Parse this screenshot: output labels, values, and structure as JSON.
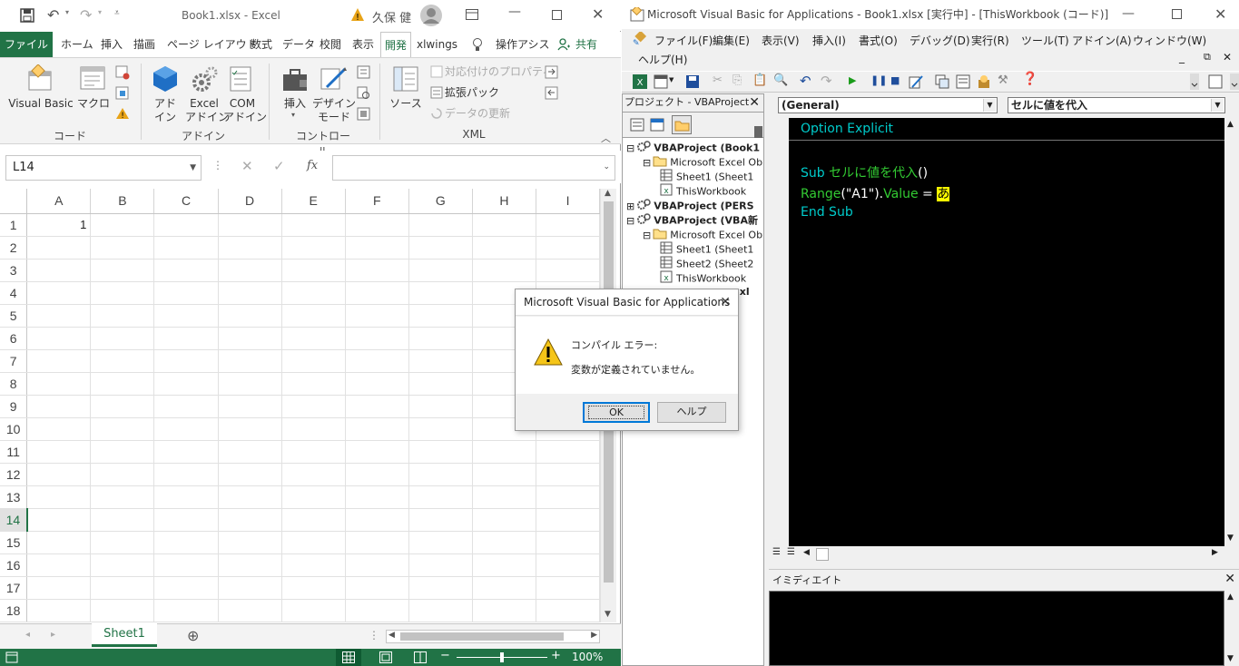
{
  "excel": {
    "title": "Book1.xlsx - Excel",
    "user": "久保 健",
    "tabs": [
      "ファイル",
      "ホーム",
      "挿入",
      "描画",
      "ページ レイアウト",
      "数式",
      "データ",
      "校閲",
      "表示",
      "開発",
      "xlwings"
    ],
    "tell_me": "操作アシス",
    "share": "共有",
    "ribbon": {
      "visual_basic": "Visual Basic",
      "macro": "マクロ",
      "addins": "アド\nイン",
      "excel_addins_1": "Excel",
      "excel_addins_2": "アドイン",
      "com_addins_1": "COM",
      "com_addins_2": "アドイン",
      "insert": "挿入",
      "design_mode_1": "デザイン",
      "design_mode_2": "モード",
      "source": "ソース",
      "map_props": "対応付けのプロパティ",
      "ext_pack": "拡張パック",
      "refresh_data": "データの更新",
      "group_code": "コード",
      "group_addins": "アドイン",
      "group_controls": "コントロール",
      "group_xml": "XML",
      "addin_a": "アド",
      "addin_b": "イン"
    },
    "name_box": "L14",
    "fx": "fx",
    "columns": [
      "A",
      "B",
      "C",
      "D",
      "E",
      "F",
      "G",
      "H",
      "I"
    ],
    "rows": [
      "1",
      "2",
      "3",
      "4",
      "5",
      "6",
      "7",
      "8",
      "9",
      "10",
      "11",
      "12",
      "13",
      "14",
      "15",
      "16",
      "17",
      "18"
    ],
    "cell_a1": "1",
    "sheet_tab": "Sheet1",
    "zoom": "100%"
  },
  "vbe": {
    "title": "Microsoft Visual Basic for Applications - Book1.xlsx [実行中] - [ThisWorkbook (コード)]",
    "menu": [
      "ファイル(F)",
      "編集(E)",
      "表示(V)",
      "挿入(I)",
      "書式(O)",
      "デバッグ(D)",
      "実行(R)",
      "ツール(T)",
      "アドイン(A)",
      "ウィンドウ(W)"
    ],
    "help_menu": "ヘルプ(H)",
    "project_title": "プロジェクト - VBAProject",
    "tree": [
      {
        "label": "VBAProject (Book1",
        "bold": true
      },
      {
        "label": "Microsoft Excel Ob",
        "bold": false
      },
      {
        "label": "Sheet1 (Sheet1",
        "bold": false
      },
      {
        "label": "ThisWorkbook",
        "bold": false
      },
      {
        "label": "VBAProject (PERS",
        "bold": true
      },
      {
        "label": "VBAProject (VBA新",
        "bold": true
      },
      {
        "label": "Microsoft Excel Ob",
        "bold": false
      },
      {
        "label": "Sheet1 (Sheet1",
        "bold": false
      },
      {
        "label": "Sheet2 (Sheet2",
        "bold": false
      },
      {
        "label": "ThisWorkbook",
        "bold": false
      },
      {
        "label": "s.xl",
        "bold": true
      }
    ],
    "combo_general": "(General)",
    "combo_proc": "セルに値を代入",
    "code": {
      "line1": "Option Explicit",
      "line2_kw": "Sub ",
      "line2_name": "セルに値を代入",
      "line2_paren": "()",
      "line3_range": "Range",
      "line3_args": "(\"A1\").",
      "line3_value": "Value",
      "line3_eq": " = ",
      "line3_hl": "あ",
      "line4": "End Sub"
    },
    "immediate_title": "イミディエイト"
  },
  "dialog": {
    "title": "Microsoft Visual Basic for Applications",
    "heading": "コンパイル エラー:",
    "message": "変数が定義されていません。",
    "ok": "OK",
    "help": "ヘルプ"
  },
  "colors": {
    "excel_green": "#217346",
    "code_bg": "#000000",
    "code_cyan": "#00cccc",
    "code_green": "#33cc33",
    "highlight": "#ffff00"
  }
}
